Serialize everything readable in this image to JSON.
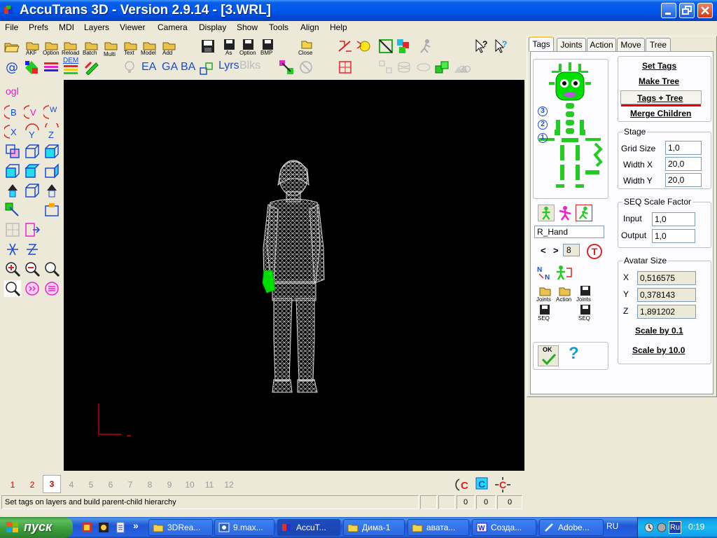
{
  "window": {
    "title": "AccuTrans 3D - Version 2.9.14 - [3.WRL]"
  },
  "menu": [
    "File",
    "Prefs",
    "MDI",
    "Layers",
    "Viewer",
    "Camera",
    "Display",
    "Show",
    "Tools",
    "Align",
    "Help"
  ],
  "toolbar": {
    "row1_labels": [
      "AKF",
      "Option",
      "Reload",
      "Batch",
      "Multi",
      "Text",
      "Model",
      "Add",
      "As",
      "Option",
      "BMP",
      "Close"
    ],
    "row2_text_buttons": [
      "EA",
      "GA",
      "BA",
      "Lyrs",
      "Blks"
    ],
    "dem_label": "DEM",
    "ogl_label": "ogl",
    "threed_label": "3D"
  },
  "left_tools": {
    "ogl_label": "ogl",
    "axis_labels": [
      "B",
      "V",
      "W",
      "X",
      "Y",
      "Z"
    ]
  },
  "tabs": [
    {
      "label": "Tags",
      "active": true
    },
    {
      "label": "Joints",
      "active": false
    },
    {
      "label": "Action",
      "active": false
    },
    {
      "label": "Move",
      "active": false
    },
    {
      "label": "Tree",
      "active": false
    }
  ],
  "tags_panel": {
    "set_tags": "Set Tags",
    "make_tree": "Make Tree",
    "tags_tree": "Tags + Tree",
    "merge_children": "Merge Children",
    "level_markers": [
      "3",
      "2",
      "1"
    ],
    "selected_tag": "R_Hand",
    "nav_prev": "<",
    "nav_next": ">",
    "tag_index": "8",
    "t_button": "T",
    "file_buttons": [
      "Joints",
      "Action",
      "Joints",
      "SEQ",
      "SEQ"
    ],
    "ok_label": "OK",
    "help_label": "?"
  },
  "stage": {
    "title": "Stage",
    "grid_size_label": "Grid Size",
    "grid_size": "1,0",
    "width_x_label": "Width X",
    "width_x": "20,0",
    "width_y_label": "Width Y",
    "width_y": "20,0"
  },
  "seq_scale": {
    "title": "SEQ Scale Factor",
    "input_label": "Input",
    "input": "1,0",
    "output_label": "Output",
    "output": "1,0"
  },
  "avatar_size": {
    "title": "Avatar Size",
    "x_label": "X",
    "x": "0,516575",
    "y_label": "Y",
    "y": "0,378143",
    "z_label": "Z",
    "z": "1,891202",
    "scale_01": "Scale by 0.1",
    "scale_10": "Scale by 10.0"
  },
  "layers": {
    "numbers": [
      "1",
      "2",
      "3",
      "4",
      "5",
      "6",
      "7",
      "8",
      "9",
      "10",
      "11",
      "12"
    ],
    "used_count": 3,
    "current": 3
  },
  "status": {
    "message": "Set tags on layers and build parent-child hierarchy",
    "values": [
      "0",
      "0",
      "0"
    ]
  },
  "taskbar": {
    "start": "пуск",
    "tasks": [
      {
        "label": "3DRea...",
        "active": false
      },
      {
        "label": "9.max...",
        "active": false
      },
      {
        "label": "AccuT...",
        "active": true
      },
      {
        "label": "Дима-1",
        "active": false
      },
      {
        "label": "авата...",
        "active": false
      },
      {
        "label": "Созда...",
        "active": false
      },
      {
        "label": "Adobe...",
        "active": false
      }
    ],
    "overflow": "»",
    "language": "RU",
    "tray_lang": "Ru",
    "clock": "0:19"
  },
  "colors": {
    "accent_green": "#00e000",
    "tag_red": "#d40000",
    "link_blue": "#1a4bd6"
  }
}
